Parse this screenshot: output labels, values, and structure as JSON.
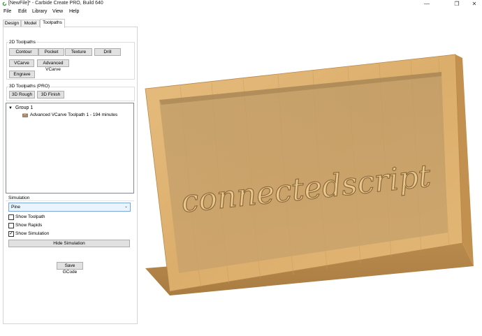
{
  "window": {
    "title": "[NewFile]* - Carbide Create PRO, Build 640",
    "minimize": "—",
    "maximize": "❐",
    "close": "✕"
  },
  "menu": [
    "File",
    "Edit",
    "Library",
    "View",
    "Help"
  ],
  "tabs": [
    "Design",
    "Model",
    "Toolpaths"
  ],
  "toolpaths_2d": {
    "title": "2D Toolpaths",
    "buttons": [
      "Contour",
      "Pocket",
      "Texture",
      "Drill",
      "VCarve",
      "Advanced VCarve",
      "Engrave"
    ]
  },
  "toolpaths_3d": {
    "title": "3D Toolpaths (PRO)",
    "buttons": [
      "3D Rough",
      "3D Finish"
    ]
  },
  "tree": {
    "group": "Group 1",
    "items": [
      "Advanced VCarve Toolpath 1 - 194 minutes"
    ]
  },
  "simulation": {
    "title": "Simulation",
    "material": "Pine",
    "options": [
      {
        "label": "Show Toolpath",
        "checked": false
      },
      {
        "label": "Show Rapids",
        "checked": false
      },
      {
        "label": "Show Simulation",
        "checked": true
      }
    ],
    "hide_button": "Hide Simulation"
  },
  "save_gcode": "Save GCode",
  "canvas": {
    "carved_text": "connectedscript"
  }
}
